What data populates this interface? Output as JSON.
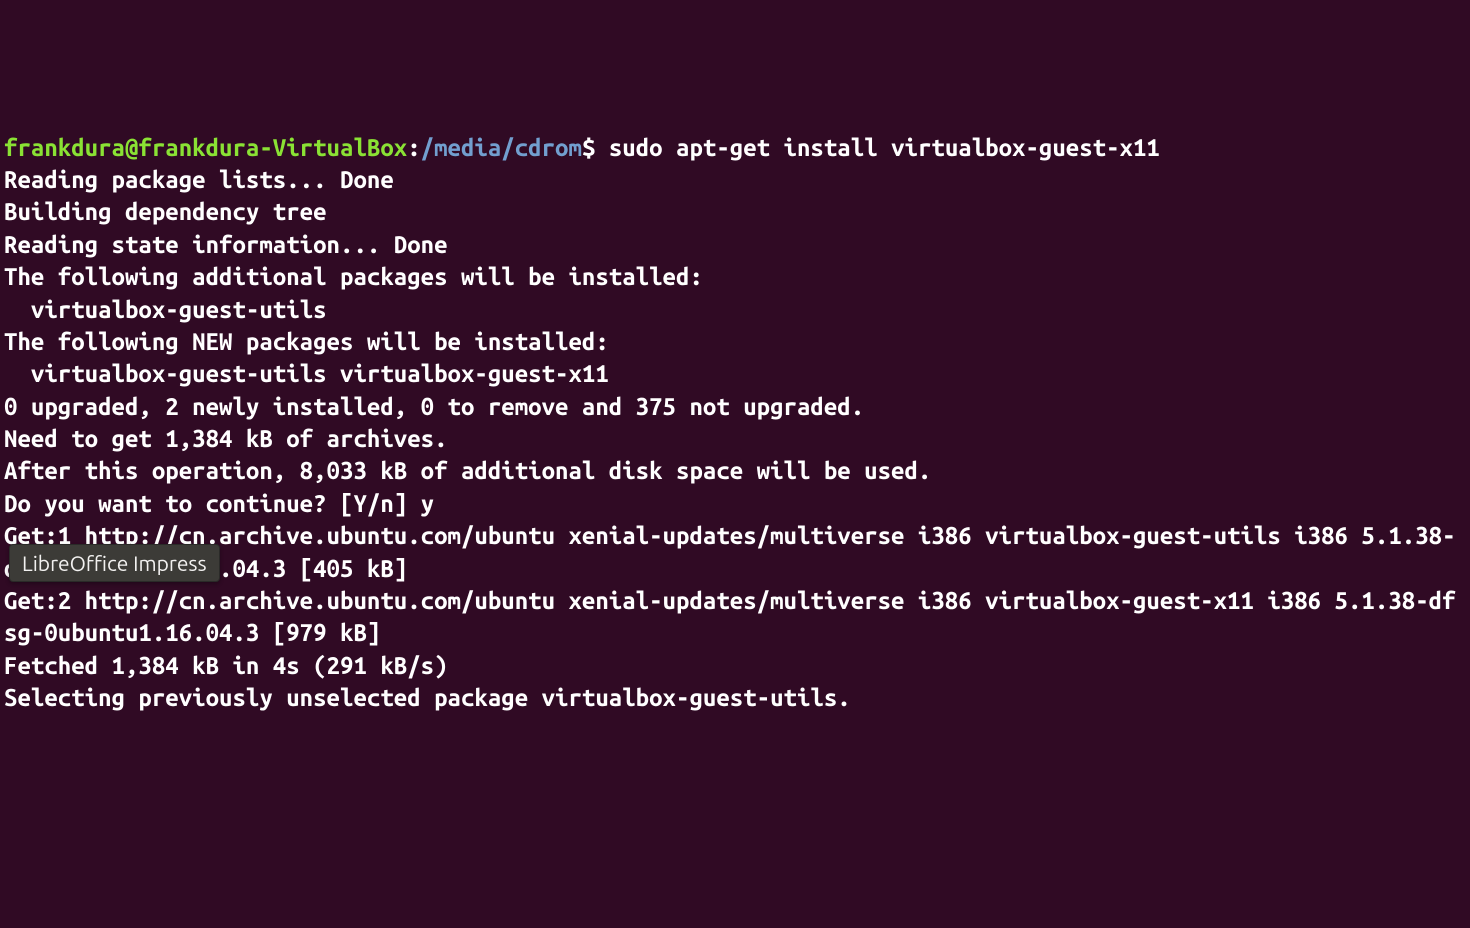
{
  "prompt": {
    "user_host": "frankdura@frankdura-VirtualBox",
    "sep1": ":",
    "path": "/media/cdrom",
    "sigil": "$"
  },
  "command": " sudo apt-get install virtualbox-guest-x11",
  "output_lines": [
    "Reading package lists... Done",
    "Building dependency tree",
    "Reading state information... Done",
    "The following additional packages will be installed:",
    "  virtualbox-guest-utils",
    "The following NEW packages will be installed:",
    "  virtualbox-guest-utils virtualbox-guest-x11",
    "0 upgraded, 2 newly installed, 0 to remove and 375 not upgraded.",
    "Need to get 1,384 kB of archives.",
    "After this operation, 8,033 kB of additional disk space will be used.",
    "Do you want to continue? [Y/n] y",
    "Get:1 http://cn.archive.ubuntu.com/ubuntu xenial-updates/multiverse i386 virtualbox-guest-utils i386 5.1.38-dfsg-0ubuntu1.16.04.3 [405 kB]",
    "Get:2 http://cn.archive.ubuntu.com/ubuntu xenial-updates/multiverse i386 virtualbox-guest-x11 i386 5.1.38-dfsg-0ubuntu1.16.04.3 [979 kB]",
    "Fetched 1,384 kB in 4s (291 kB/s)",
    "Selecting previously unselected package virtualbox-guest-utils."
  ],
  "tooltip": {
    "label": "LibreOffice Impress"
  }
}
